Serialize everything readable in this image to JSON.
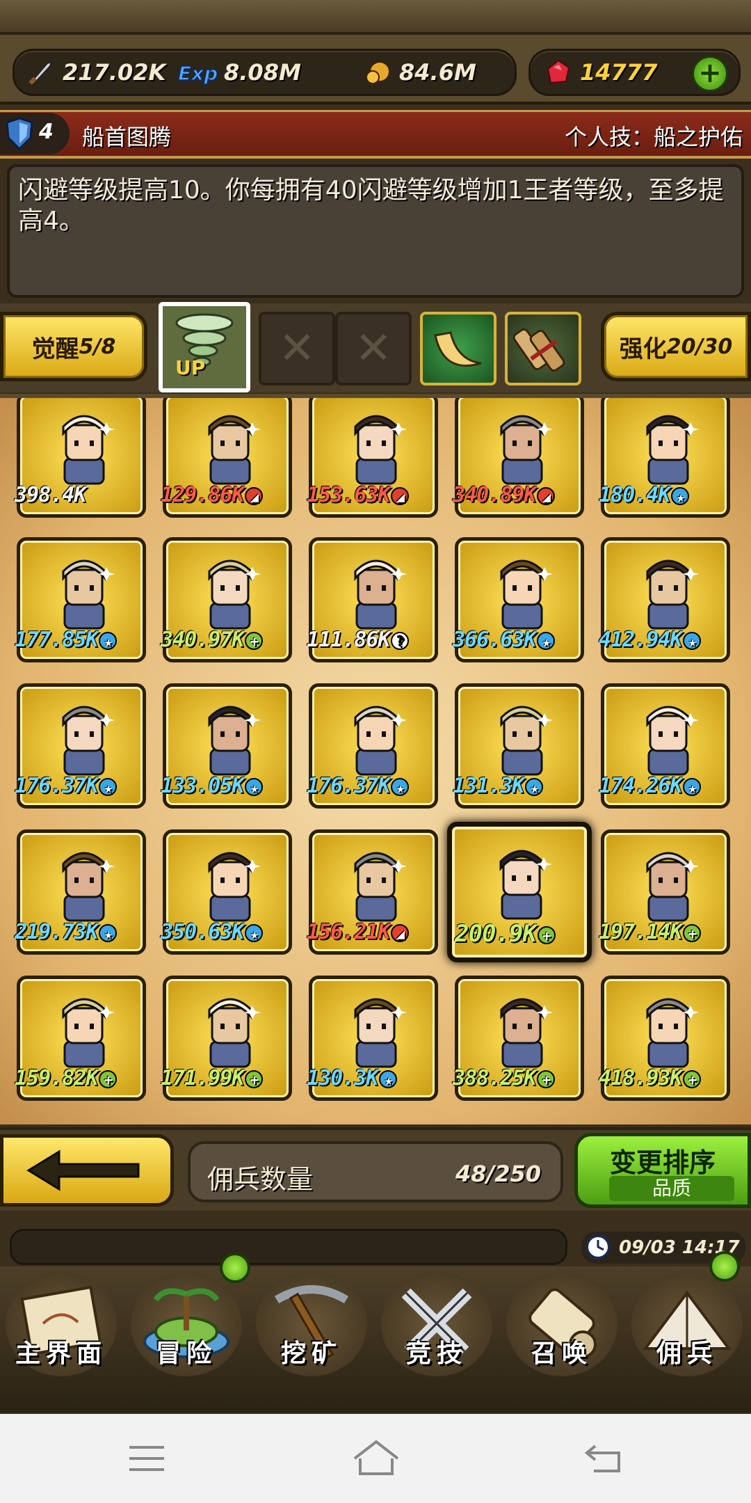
{
  "resources": {
    "attack": "217.02K",
    "exp": "8.08M",
    "gold": "84.6M",
    "gems": "14777"
  },
  "skill": {
    "level": "4",
    "name": "船首图腾",
    "personal_skill": "个人技：船之护佑",
    "description": "闪避等级提高10。你每拥有40闪避等级增加1王者等级，至多提高4。"
  },
  "awaken": {
    "label": "觉醒",
    "value": "5/8",
    "up_label": "UP"
  },
  "enhance": {
    "label": "强化",
    "value": "20/30"
  },
  "mercenaries": [
    {
      "power": "398.4K",
      "color": "white",
      "badge": ""
    },
    {
      "power": "129.86K",
      "color": "red",
      "badge": "red"
    },
    {
      "power": "153.63K",
      "color": "red",
      "badge": "red"
    },
    {
      "power": "340.89K",
      "color": "red",
      "badge": "red"
    },
    {
      "power": "180.4K",
      "color": "blue",
      "badge": "blue"
    },
    {
      "power": "177.85K",
      "color": "blue",
      "badge": "blue"
    },
    {
      "power": "340.97K",
      "color": "green",
      "badge": "green"
    },
    {
      "power": "111.86K",
      "color": "white",
      "badge": "white"
    },
    {
      "power": "366.63K",
      "color": "blue",
      "badge": "blue"
    },
    {
      "power": "412.94K",
      "color": "blue",
      "badge": "blue"
    },
    {
      "power": "176.37K",
      "color": "blue",
      "badge": "blue"
    },
    {
      "power": "133.05K",
      "color": "blue",
      "badge": "blue"
    },
    {
      "power": "176.37K",
      "color": "blue",
      "badge": "blue"
    },
    {
      "power": "131.3K",
      "color": "blue",
      "badge": "blue"
    },
    {
      "power": "174.26K",
      "color": "blue",
      "badge": "blue"
    },
    {
      "power": "219.73K",
      "color": "blue",
      "badge": "blue"
    },
    {
      "power": "350.63K",
      "color": "blue",
      "badge": "blue"
    },
    {
      "power": "156.21K",
      "color": "red",
      "badge": "red"
    },
    {
      "power": "200.9K",
      "color": "green",
      "badge": "green"
    },
    {
      "power": "197.14K",
      "color": "green",
      "badge": "green"
    },
    {
      "power": "159.82K",
      "color": "green",
      "badge": "green"
    },
    {
      "power": "171.99K",
      "color": "green",
      "badge": "green"
    },
    {
      "power": "130.3K",
      "color": "blue",
      "badge": "blue"
    },
    {
      "power": "388.25K",
      "color": "green",
      "badge": "green"
    },
    {
      "power": "418.93K",
      "color": "green",
      "badge": "green"
    }
  ],
  "footer": {
    "count_label": "佣兵数量",
    "count_value": "48/250",
    "sort_label": "变更排序",
    "sort_sub": "品质"
  },
  "clock": "09/03 14:17",
  "nav": [
    {
      "label": "主界面"
    },
    {
      "label": "冒险"
    },
    {
      "label": "挖矿"
    },
    {
      "label": "竞技"
    },
    {
      "label": "召唤"
    },
    {
      "label": "佣兵"
    }
  ],
  "colors": {
    "gold_card": "#ffd23a",
    "power_red": "#ff5a4a",
    "power_blue": "#6ad8ff",
    "power_green": "#c7f06a",
    "accent_green": "#8fe23a"
  }
}
